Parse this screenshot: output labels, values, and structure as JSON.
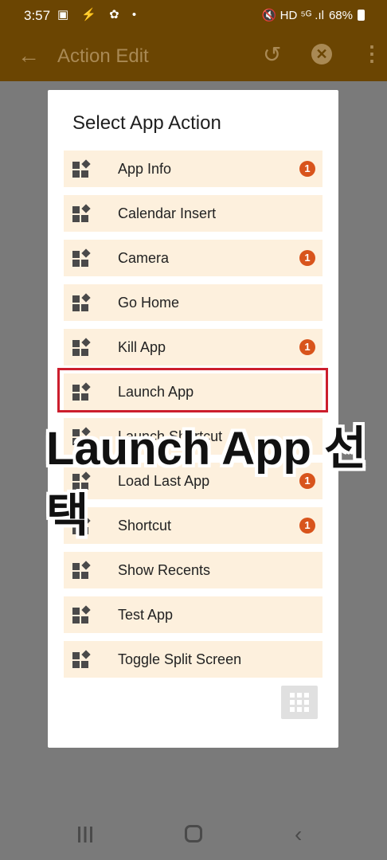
{
  "status": {
    "time": "3:57",
    "left_icons": "▣ ⚡ ✿ •",
    "right_text": "🔇 HD ⁵ᴳ .ıl",
    "battery": "68%"
  },
  "appbar": {
    "back_icon": "arrow-left-icon",
    "title": "Action Edit",
    "undo_icon": "↺",
    "close_icon": "✕",
    "more_icon": "⋮"
  },
  "dialog": {
    "title": "Select App Action",
    "items": [
      {
        "label": "App Info",
        "badge": "1"
      },
      {
        "label": "Calendar Insert",
        "badge": ""
      },
      {
        "label": "Camera",
        "badge": "1"
      },
      {
        "label": "Go Home",
        "badge": ""
      },
      {
        "label": "Kill App",
        "badge": "1"
      },
      {
        "label": "Launch App",
        "badge": ""
      },
      {
        "label": "Launch Shortcut",
        "badge": ""
      },
      {
        "label": "Load Last App",
        "badge": "1"
      },
      {
        "label": "Shortcut",
        "badge": "1"
      },
      {
        "label": "Show Recents",
        "badge": ""
      },
      {
        "label": "Test App",
        "badge": ""
      },
      {
        "label": "Toggle Split Screen",
        "badge": ""
      }
    ]
  },
  "overlay_caption": "Launch App 선택",
  "colors": {
    "appbar": "#6b4502",
    "item_bg": "#fdf0dd",
    "badge": "#d8541c",
    "highlight": "#cc1e2d"
  }
}
